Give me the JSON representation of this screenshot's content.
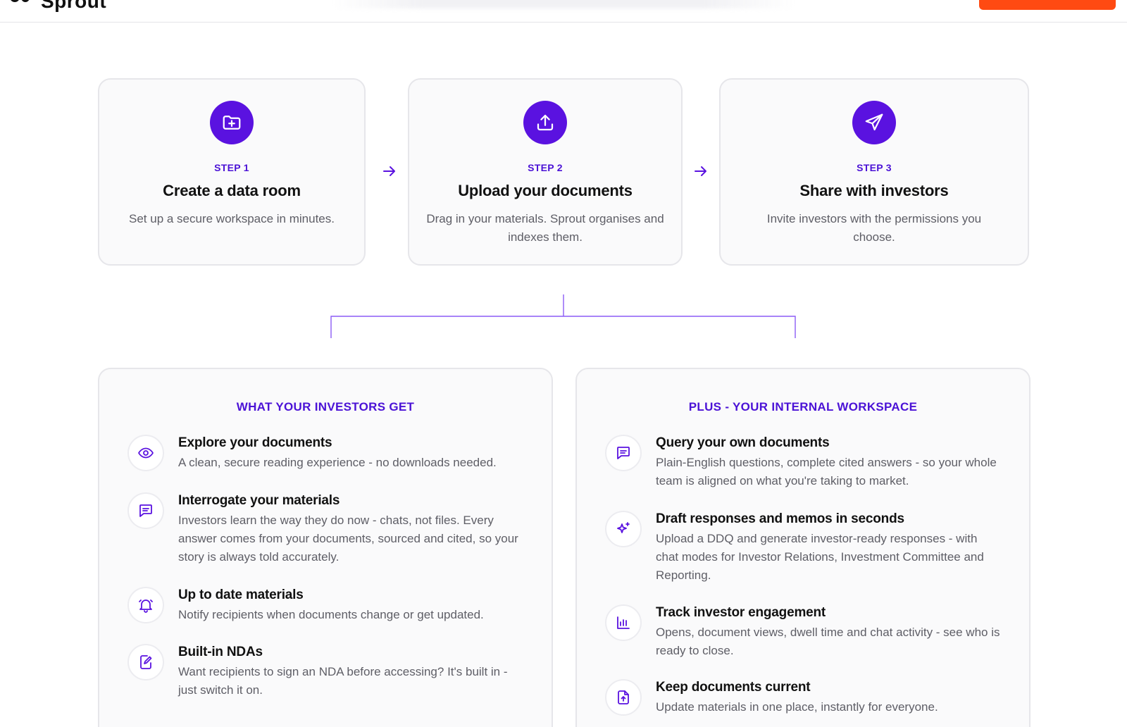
{
  "brand": {
    "name": "Sprout"
  },
  "colors": {
    "accent": "#5a12e0",
    "accent_text": "#4b12d6",
    "cta": "#ff4a12"
  },
  "steps": [
    {
      "label": "STEP 1",
      "title": "Create a data room",
      "description": "Set up a secure workspace in minutes.",
      "icon": "folder-plus-icon"
    },
    {
      "label": "STEP 2",
      "title": "Upload your documents",
      "description": "Drag in your materials. Sprout organises and indexes them.",
      "icon": "upload-icon"
    },
    {
      "label": "STEP 3",
      "title": "Share with investors",
      "description": "Invite investors with the permissions you choose.",
      "icon": "send-icon"
    }
  ],
  "investors_panel": {
    "title": "WHAT YOUR INVESTORS GET",
    "features": [
      {
        "title": "Explore your documents",
        "description": "A clean, secure reading experience - no downloads needed.",
        "icon": "eye-icon"
      },
      {
        "title": "Interrogate your materials",
        "description": "Investors learn the way they do now - chats, not files. Every answer comes from your documents, sourced and cited, so your story is always told accurately.",
        "icon": "chat-icon"
      },
      {
        "title": "Up to date materials",
        "description": "Notify recipients when documents change or get updated.",
        "icon": "bell-icon"
      },
      {
        "title": "Built-in NDAs",
        "description": "Want recipients to sign an NDA before accessing? It's built in - just switch it on.",
        "icon": "edit-document-icon"
      }
    ]
  },
  "internal_panel": {
    "title": "PLUS - YOUR INTERNAL WORKSPACE",
    "features": [
      {
        "title": "Query your own documents",
        "description": "Plain-English questions, complete cited answers - so your whole team is aligned on what you're taking to market.",
        "icon": "chat-icon"
      },
      {
        "title": "Draft responses and memos in seconds",
        "description": "Upload a DDQ and generate investor-ready responses - with chat modes for Investor Relations, Investment Committee and Reporting.",
        "icon": "sparkle-icon"
      },
      {
        "title": "Track investor engagement",
        "description": "Opens, document views, dwell time and chat activity - see who is ready to close.",
        "icon": "bar-chart-icon"
      },
      {
        "title": "Keep documents current",
        "description": "Update materials in one place, instantly for everyone.",
        "icon": "file-upload-icon"
      }
    ]
  }
}
